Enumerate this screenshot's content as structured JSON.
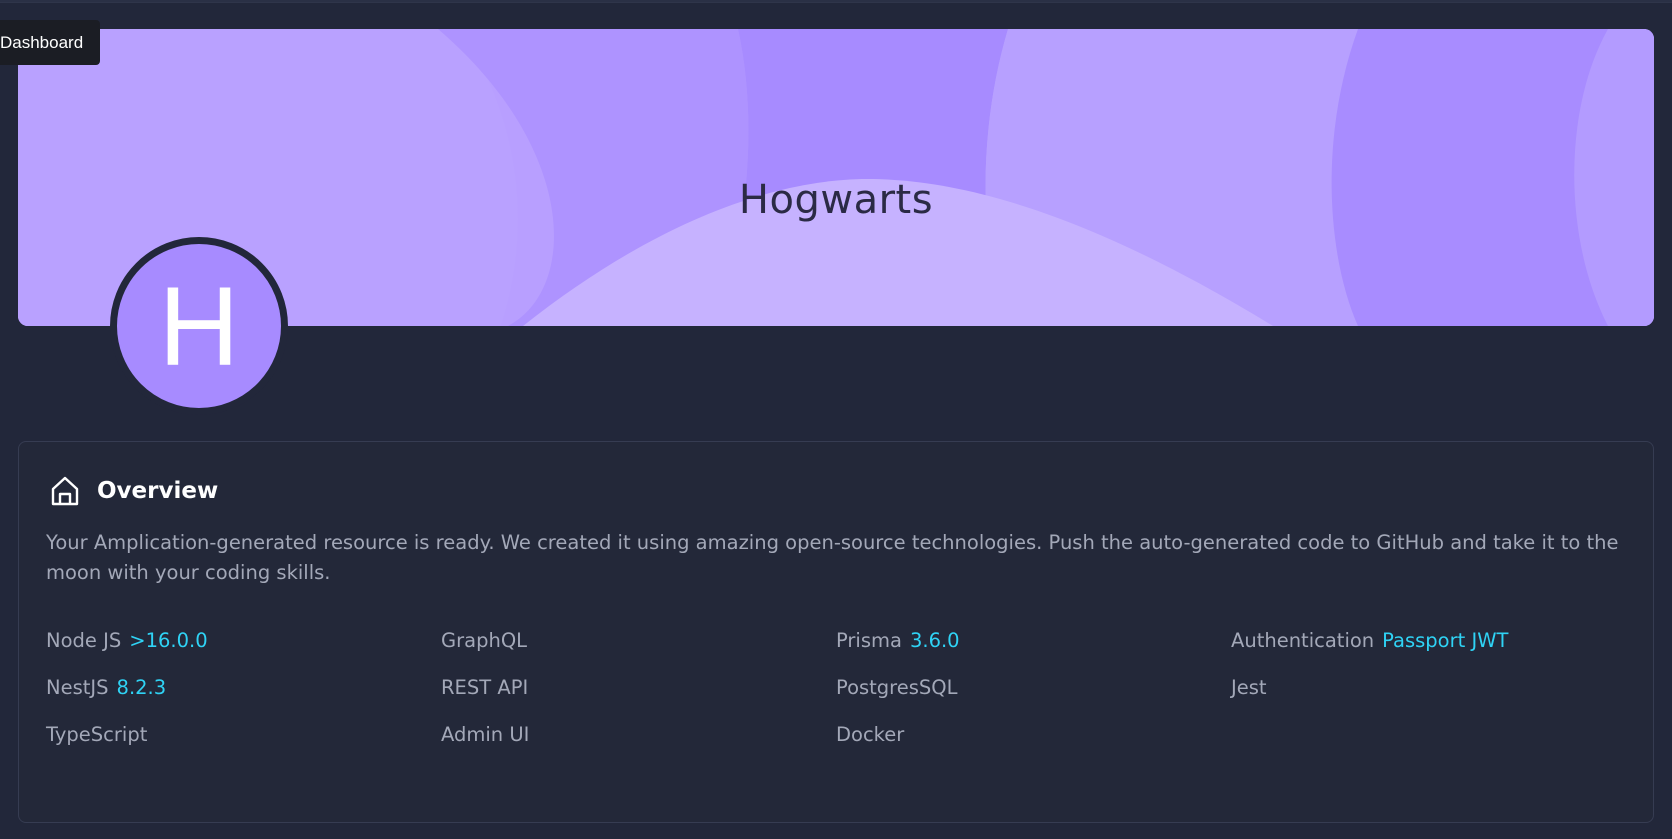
{
  "tooltip": {
    "text": "Dashboard"
  },
  "banner": {
    "title": "Hogwarts"
  },
  "avatar": {
    "letter": "H"
  },
  "overview": {
    "title": "Overview",
    "description": "Your Amplication-generated resource is ready. We created it using amazing open-source technologies. Push the auto-generated code to GitHub and take it to the moon with your coding skills."
  },
  "colors": {
    "background": "#22273a",
    "banner": "#b49cff",
    "avatar": "#a78bff",
    "version_accent": "#2fd3f5",
    "text_muted": "#a3a8b8"
  },
  "technologies": [
    {
      "name": "Node JS",
      "version": ">16.0.0"
    },
    {
      "name": "GraphQL",
      "version": ""
    },
    {
      "name": "Prisma",
      "version": "3.6.0"
    },
    {
      "name": "Authentication",
      "version": "Passport JWT"
    },
    {
      "name": "NestJS",
      "version": "8.2.3"
    },
    {
      "name": "REST API",
      "version": ""
    },
    {
      "name": "PostgresSQL",
      "version": ""
    },
    {
      "name": "Jest",
      "version": ""
    },
    {
      "name": "TypeScript",
      "version": ""
    },
    {
      "name": "Admin UI",
      "version": ""
    },
    {
      "name": "Docker",
      "version": ""
    }
  ]
}
